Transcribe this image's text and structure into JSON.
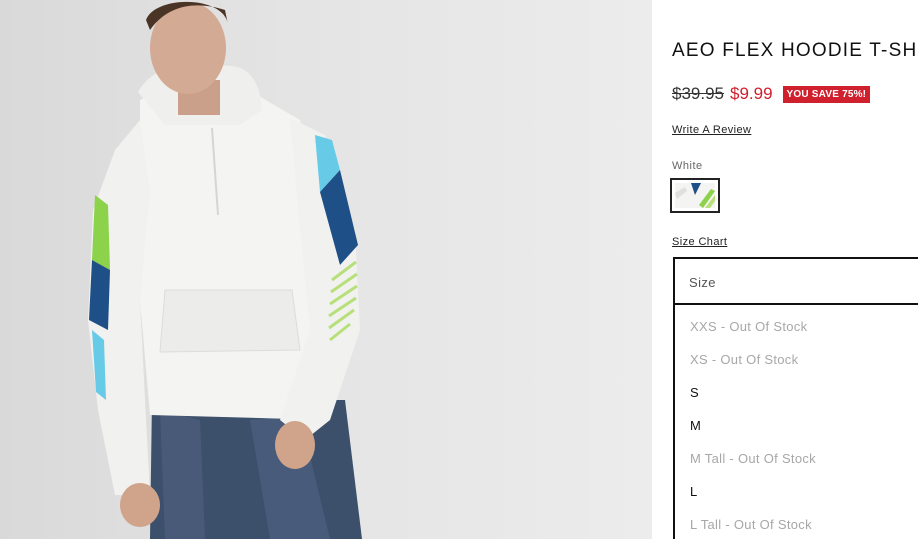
{
  "product": {
    "title": "AEO FLEX HOODIE T-SHIRT",
    "original_price": "$39.95",
    "sale_price": "$9.99",
    "save_badge": "YOU SAVE 75%!",
    "review_link": "Write A Review"
  },
  "color": {
    "label": "White",
    "swatch_icon": "hoodie-swatch-white",
    "accent_colors": [
      "#1e4f86",
      "#8cd24a",
      "#67cbe8"
    ]
  },
  "size": {
    "chart_link": "Size Chart",
    "select_placeholder": "Size",
    "options": [
      {
        "label": "XXS - Out Of Stock",
        "available": false
      },
      {
        "label": "XS - Out Of Stock",
        "available": false
      },
      {
        "label": "S",
        "available": true
      },
      {
        "label": "M",
        "available": true
      },
      {
        "label": "M Tall - Out Of Stock",
        "available": false
      },
      {
        "label": "L",
        "available": true
      },
      {
        "label": "L Tall - Out Of Stock",
        "available": false
      }
    ]
  },
  "colors": {
    "sale_red": "#d0202e",
    "text_dark": "#111111",
    "text_muted": "#a7a7a7",
    "photo_bg": "#e2e2e2"
  }
}
